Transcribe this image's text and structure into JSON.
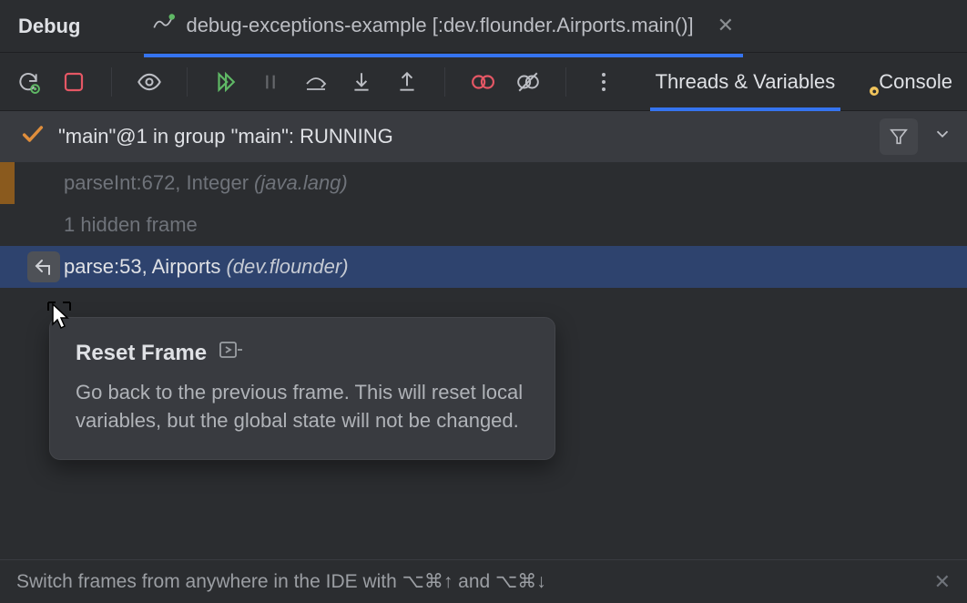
{
  "tabs": {
    "debug_label": "Debug",
    "run_label": "debug-exceptions-example [:dev.flounder.Airports.main()]"
  },
  "toolbar": {
    "tabs": {
      "threads": "Threads & Variables",
      "console": "Console"
    }
  },
  "thread": {
    "status": "\"main\"@1 in group \"main\": RUNNING"
  },
  "frames": [
    {
      "method": "parseInt:672, Integer",
      "pkg": "(java.lang)",
      "accent": true,
      "faded": true
    },
    {
      "method": "1 hidden frame",
      "pkg": "",
      "accent": false,
      "faded": true
    },
    {
      "method": "parse:53, Airports",
      "pkg": "(dev.flounder)",
      "accent": false,
      "selected": true
    }
  ],
  "tooltip": {
    "title": "Reset Frame",
    "body": "Go back to the previous frame. This will reset local variables, but the global state will not be changed."
  },
  "footer": {
    "text": "Switch frames from anywhere in the IDE with ⌥⌘↑ and ⌥⌘↓"
  }
}
